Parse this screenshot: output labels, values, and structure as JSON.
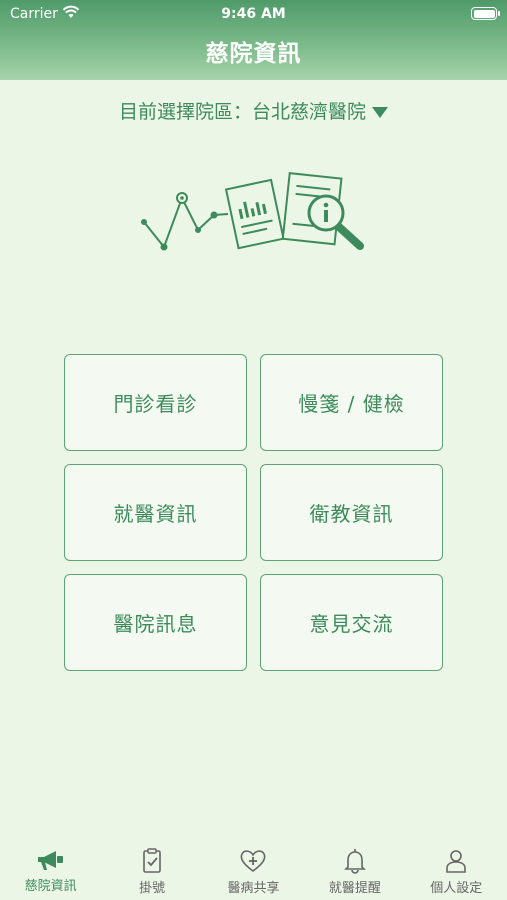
{
  "status_bar": {
    "carrier": "Carrier",
    "time": "9:46 AM"
  },
  "header": {
    "title": "慈院資訊"
  },
  "hospital": {
    "label": "目前選擇院區：",
    "name": "台北慈濟醫院"
  },
  "menu": [
    {
      "label": "門診看診"
    },
    {
      "label": "慢箋 / 健檢"
    },
    {
      "label": "就醫資訊"
    },
    {
      "label": "衛教資訊"
    },
    {
      "label": "醫院訊息"
    },
    {
      "label": "意見交流"
    }
  ],
  "tabs": [
    {
      "label": "慈院資訊",
      "icon": "megaphone-icon",
      "active": true
    },
    {
      "label": "掛號",
      "icon": "clipboard-check-icon",
      "active": false
    },
    {
      "label": "醫病共享",
      "icon": "heart-plus-icon",
      "active": false
    },
    {
      "label": "就醫提醒",
      "icon": "bell-icon",
      "active": false
    },
    {
      "label": "個人設定",
      "icon": "person-icon",
      "active": false
    }
  ],
  "colors": {
    "accent": "#3d8b5c",
    "header": "#4f9a6a",
    "background": "#ecf6e6",
    "inactive": "#666666"
  }
}
